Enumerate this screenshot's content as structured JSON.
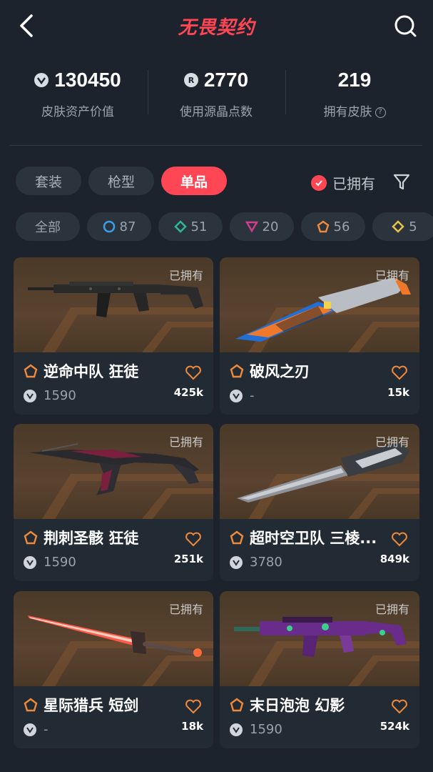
{
  "header": {
    "title": "无畏契约"
  },
  "stats": [
    {
      "value": "130450",
      "label": "皮肤资产价值",
      "icon": "vp-coin-icon"
    },
    {
      "value": "2770",
      "label": "使用源晶点数",
      "icon": "radianite-icon"
    },
    {
      "value": "219",
      "label": "拥有皮肤",
      "icon": ""
    }
  ],
  "help_mark": "?",
  "tabs": [
    "套装",
    "枪型",
    "单品"
  ],
  "active_tab": "单品",
  "owned_filter": {
    "label": "已拥有",
    "checked": true
  },
  "chips": [
    {
      "label": "全部",
      "count": ""
    },
    {
      "label": "",
      "count": "87",
      "color": "#3aa0e8"
    },
    {
      "label": "",
      "count": "51",
      "color": "#2fb89a"
    },
    {
      "label": "",
      "count": "20",
      "color": "#d23c8c"
    },
    {
      "label": "",
      "count": "56",
      "color": "#f08a3a"
    },
    {
      "label": "",
      "count": "5",
      "color": "#e8c34a"
    }
  ],
  "cards": [
    {
      "owned": "已拥有",
      "name": "逆命中队 狂徒",
      "price": "1590",
      "likes": "425k"
    },
    {
      "owned": "已拥有",
      "name": "破风之刃",
      "price": "-",
      "likes": "15k"
    },
    {
      "owned": "已拥有",
      "name": "荆刺圣骸 狂徒",
      "price": "1590",
      "likes": "251k"
    },
    {
      "owned": "已拥有",
      "name": "超时空卫队 三棱...",
      "price": "3780",
      "likes": "849k"
    },
    {
      "owned": "已拥有",
      "name": "星际猎兵 短剑",
      "price": "-",
      "likes": "18k"
    },
    {
      "owned": "已拥有",
      "name": "末日泡泡 幻影",
      "price": "1590",
      "likes": "524k"
    }
  ],
  "colors": {
    "accent": "#ff4655",
    "tier": "#f08a3a",
    "bg": "#1c232c"
  }
}
